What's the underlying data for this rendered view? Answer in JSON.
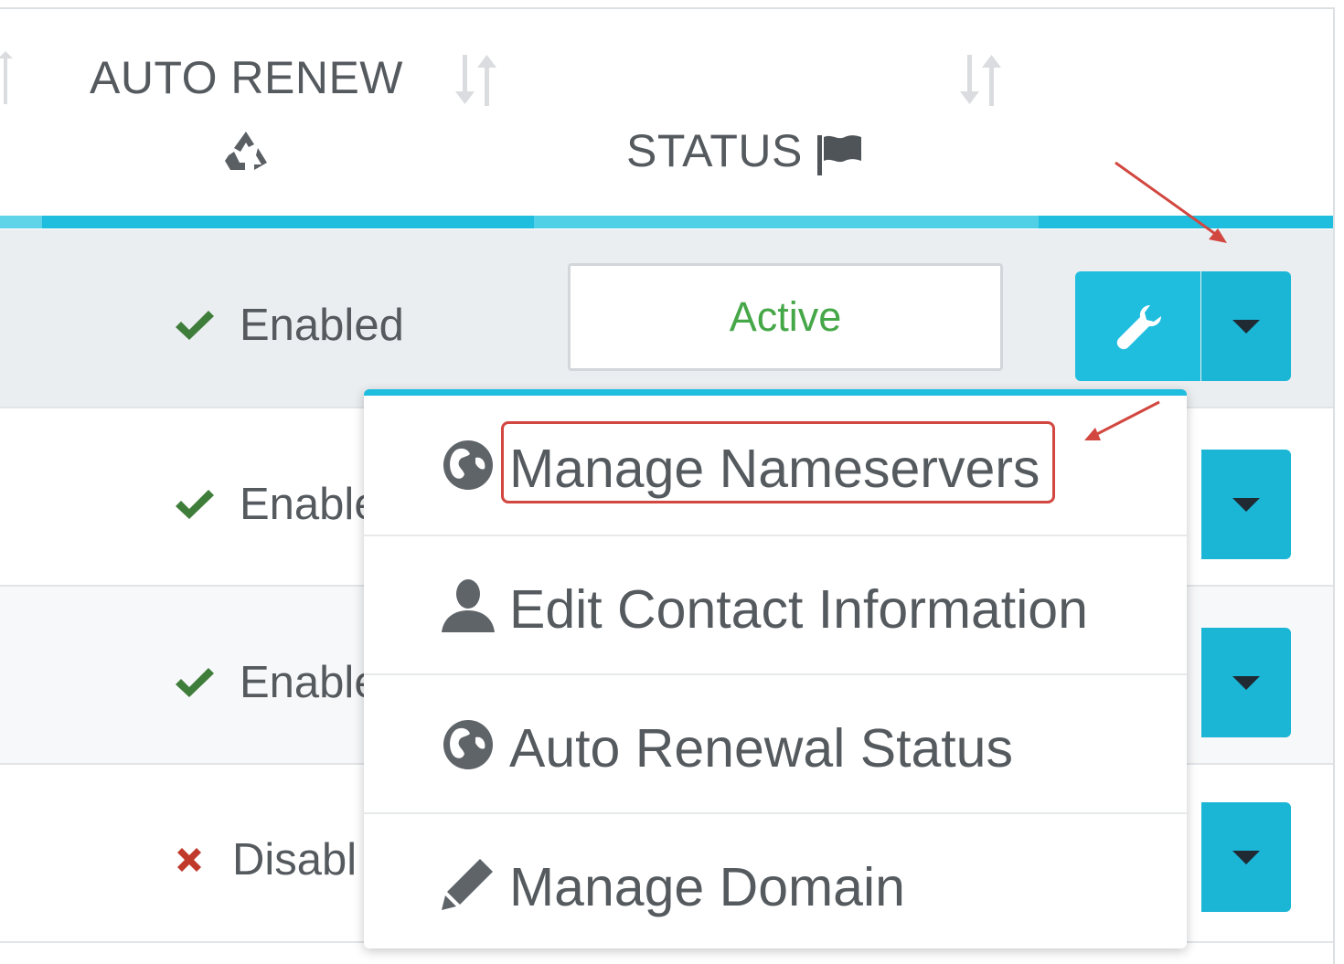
{
  "header": {
    "auto_renew_label": "AUTO RENEW",
    "status_label": "STATUS"
  },
  "rows": [
    {
      "auto_renew": "Enabled",
      "auto_renew_state": "enabled",
      "status": "Active"
    },
    {
      "auto_renew": "Enable",
      "auto_renew_state": "enabled"
    },
    {
      "auto_renew": "Enable",
      "auto_renew_state": "enabled"
    },
    {
      "auto_renew": "Disabl",
      "auto_renew_state": "disabled"
    }
  ],
  "dropdown": {
    "items": [
      {
        "label": "Manage Nameservers",
        "icon": "globe-icon"
      },
      {
        "label": "Edit Contact Information",
        "icon": "user-icon"
      },
      {
        "label": "Auto Renewal Status",
        "icon": "globe-icon"
      },
      {
        "label": "Manage Domain",
        "icon": "pencil-icon"
      }
    ]
  },
  "colors": {
    "accent": "#1fbdde",
    "enabled": "#3f7d3a",
    "disabled": "#c0392b",
    "active_text": "#46a748",
    "annotation": "#d2473f"
  }
}
